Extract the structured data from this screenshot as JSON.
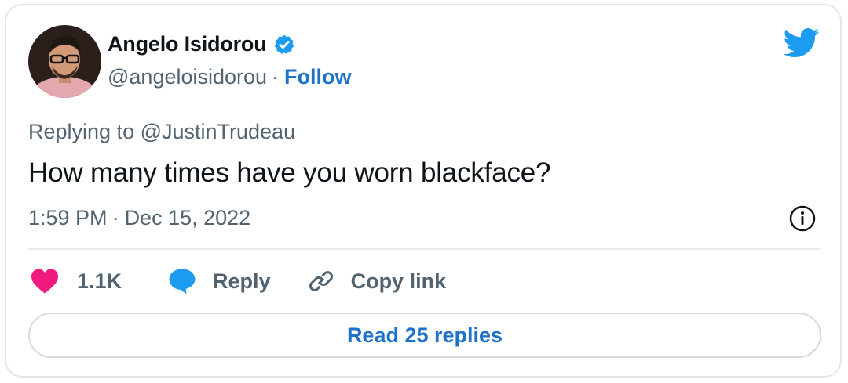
{
  "author": {
    "name": "Angelo Isidorou",
    "handle": "@angeloisidorou",
    "separator": "·",
    "follow_label": "Follow"
  },
  "tweet": {
    "replying_to": "Replying to @JustinTrudeau",
    "text": "How many times have you worn blackface?",
    "time": "1:59 PM",
    "date_separator": "·",
    "date": "Dec 15, 2022"
  },
  "actions": {
    "like_count": "1.1K",
    "reply_label": "Reply",
    "copy_link_label": "Copy link"
  },
  "read_replies_label": "Read 25 replies",
  "icons": {
    "verified": "verified-badge-icon",
    "brand": "twitter-bird-icon",
    "info": "info-icon",
    "like": "heart-icon",
    "reply": "speech-bubble-icon",
    "copy": "link-icon"
  },
  "colors": {
    "twitter_blue": "#1d9bf0",
    "link_blue": "#1d72c9",
    "heart": "#f0197d",
    "text_primary": "#0f1419",
    "text_secondary": "#536471",
    "border": "#e3e6ea"
  }
}
